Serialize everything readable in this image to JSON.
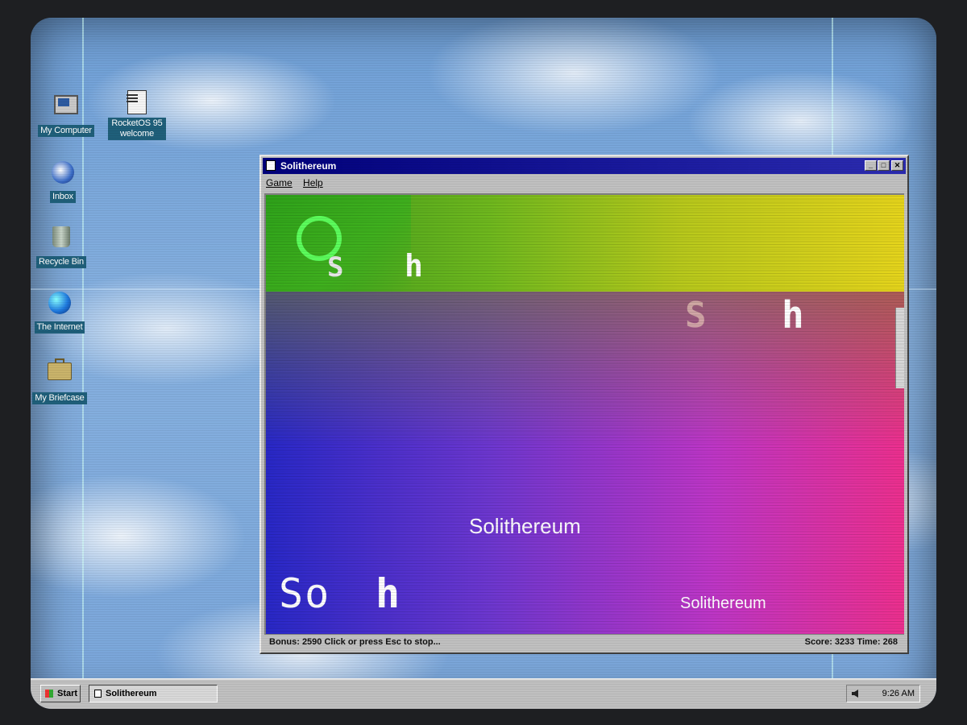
{
  "desktop": {
    "icons": [
      {
        "label": "My Computer",
        "icon": "computer-icon"
      },
      {
        "label": "RocketOS 95 welcome",
        "icon": "document-icon"
      },
      {
        "label": "Inbox",
        "icon": "inbox-icon"
      },
      {
        "label": "Recycle Bin",
        "icon": "recycle-bin-icon"
      },
      {
        "label": "The Internet",
        "icon": "globe-icon"
      },
      {
        "label": "My Briefcase",
        "icon": "briefcase-icon"
      }
    ]
  },
  "window": {
    "title": "Solithereum",
    "menu": [
      "Game",
      "Help"
    ],
    "buttons": {
      "minimize": "_",
      "maximize": "□",
      "close": "✕"
    },
    "playfield": {
      "fragments": [
        "S",
        "h",
        "S",
        "h",
        "So",
        "h"
      ],
      "title_center": "Solithereum",
      "title_corner": "Solithereum"
    },
    "status": {
      "left": "Bonus: 2590  Click or press Esc to stop...",
      "right": "Score: 3233 Time: 268"
    }
  },
  "taskbar": {
    "start_label": "Start",
    "task": "Solithereum",
    "clock": "9:26 AM"
  },
  "colors": {
    "title_bar": "#00007a",
    "ring": "#5cff5c",
    "chrome": "#c0c0c0"
  }
}
